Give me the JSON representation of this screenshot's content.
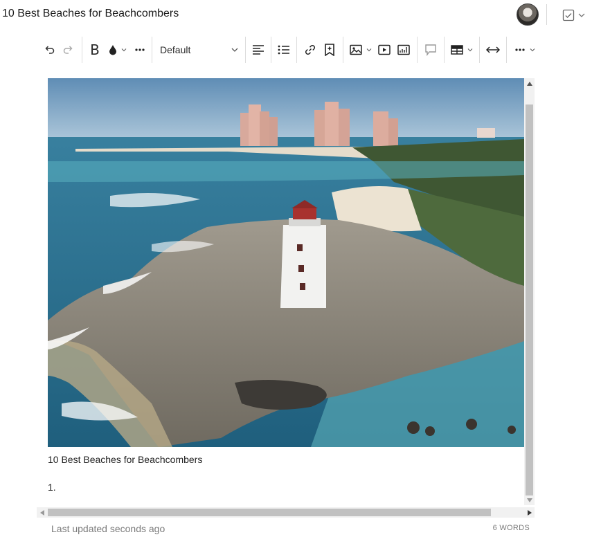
{
  "document": {
    "title": "10 Best Beaches for Beachcombers"
  },
  "header": {
    "avatar": "user-avatar",
    "status_icon": "checkbox-icon"
  },
  "toolbar": {
    "undo": "undo-icon",
    "redo": "redo-icon",
    "bold": "B",
    "text_color": "ink-drop-icon",
    "more_formatting": "ellipsis-icon",
    "paragraph_format": "Default",
    "align": "align-left-icon",
    "list": "bullet-list-icon",
    "link": "link-icon",
    "bookmark": "bookmark-add-icon",
    "image": "image-icon",
    "video": "video-icon",
    "chart": "chart-icon",
    "comment": "comment-icon",
    "table": "table-icon",
    "code": "code-icon",
    "more": "more-icon"
  },
  "content": {
    "image_alt": "Lighthouse on a rocky point with a beach and resort towers in the background",
    "caption": "10 Best Beaches for Beachcombers",
    "list_start": "1."
  },
  "footer": {
    "last_updated": "Last updated seconds ago",
    "word_count": "6 WORDS"
  },
  "colors": {
    "sky": "#7fa3c4",
    "sea": "#2f7a99",
    "rock": "#8b8478",
    "foliage": "#4a5a3a",
    "lighthouse_top": "#a8322e",
    "scrollbar_thumb": "#c1c1c1"
  }
}
